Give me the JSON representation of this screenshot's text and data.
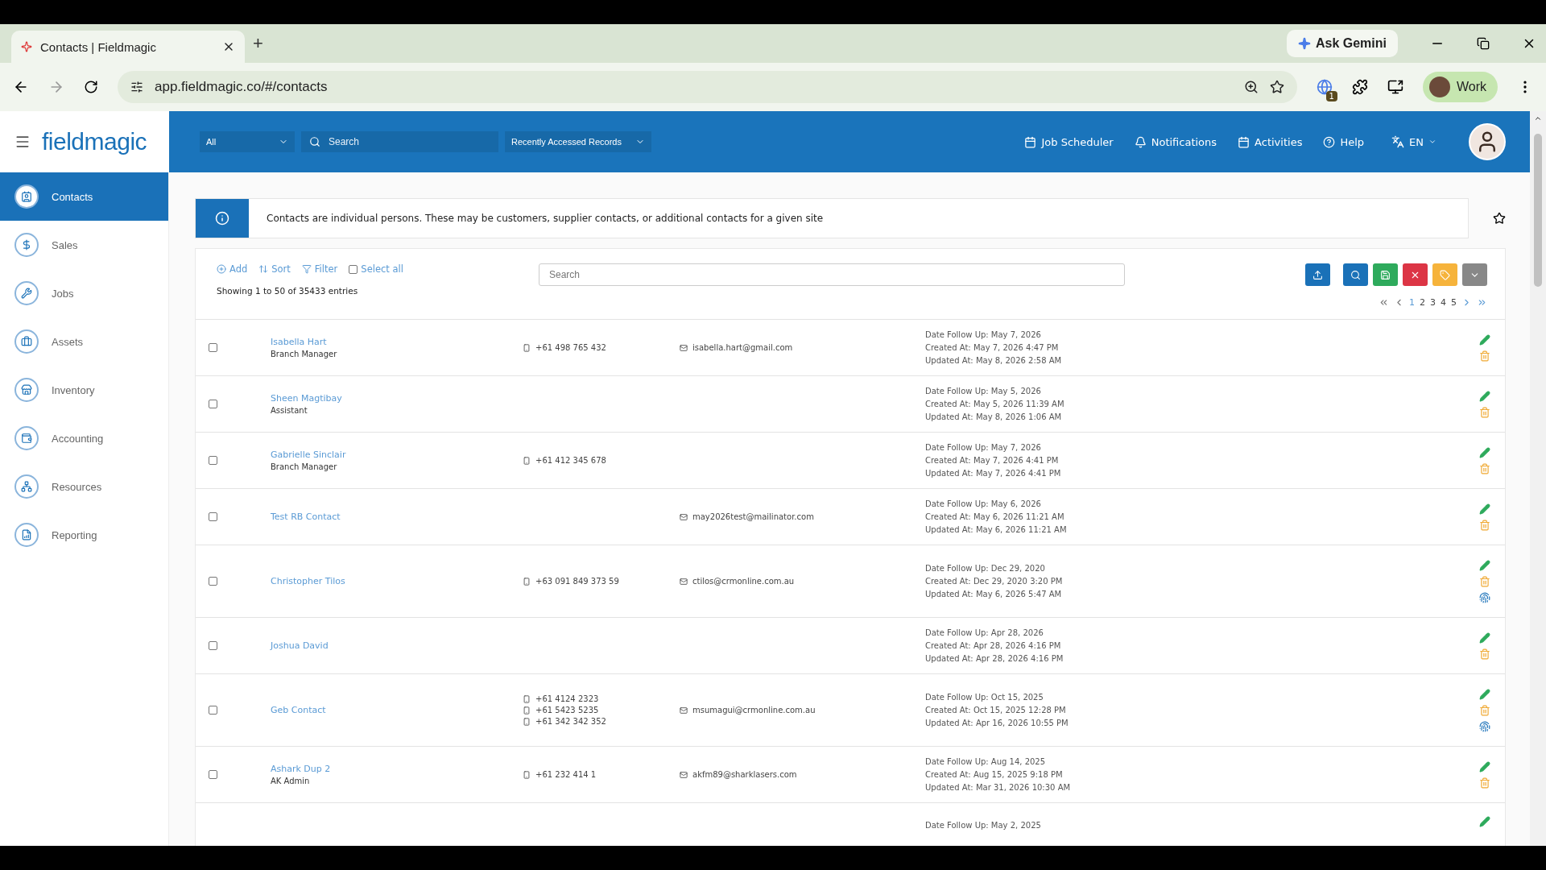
{
  "browser": {
    "tab_title": "Contacts | Fieldmagic",
    "new_tab": "+",
    "ask_gemini": "Ask Gemini",
    "url": "app.fieldmagic.co/#/contacts",
    "extension_badge": "1",
    "profile": "Work"
  },
  "header": {
    "logo": "fieldmagic",
    "scope": "All",
    "search_placeholder": "Search",
    "recent": "Recently Accessed Records",
    "nav": [
      "Job Scheduler",
      "Notifications",
      "Activities",
      "Help"
    ],
    "language": "EN"
  },
  "sidebar": {
    "items": [
      {
        "label": "Contacts",
        "selected": true
      },
      {
        "label": "Sales",
        "selected": false
      },
      {
        "label": "Jobs",
        "selected": false
      },
      {
        "label": "Assets",
        "selected": false
      },
      {
        "label": "Inventory",
        "selected": false
      },
      {
        "label": "Accounting",
        "selected": false
      },
      {
        "label": "Resources",
        "selected": false
      },
      {
        "label": "Reporting",
        "selected": false
      }
    ]
  },
  "info": "Contacts are individual persons. These may be customers, supplier contacts, or additional contacts for a given site",
  "toolbar": {
    "actions": [
      "Add",
      "Sort",
      "Filter"
    ],
    "select_all": {
      "label": "Select all",
      "checked": false
    },
    "search_placeholder": "Search",
    "entries": "Showing 1 to 50 of 35433 entries",
    "pages": [
      {
        "label": "1",
        "selected": true
      },
      {
        "label": "2",
        "selected": false
      },
      {
        "label": "3",
        "selected": false
      },
      {
        "label": "4",
        "selected": false
      },
      {
        "label": "5",
        "selected": false
      }
    ]
  },
  "rows": [
    {
      "checked": false,
      "name": "Isabella Hart",
      "role": "Branch Manager",
      "phones": [
        "+61 498 765 432"
      ],
      "email": "isabella.hart@gmail.com",
      "follow_up": "Date Follow Up: May 7, 2026",
      "created": "Created At: May 7, 2026 4:47 PM",
      "updated": "Updated At: May 8, 2026 2:58 AM",
      "fingerprint": false
    },
    {
      "checked": false,
      "name": "Sheen Magtibay",
      "role": "Assistant",
      "phones": [],
      "follow_up": "Date Follow Up: May 5, 2026",
      "created": "Created At: May 5, 2026 11:39 AM",
      "updated": "Updated At: May 8, 2026 1:06 AM",
      "fingerprint": false
    },
    {
      "checked": false,
      "name": "Gabrielle Sinclair",
      "role": "Branch Manager",
      "phones": [
        "+61 412 345 678"
      ],
      "follow_up": "Date Follow Up: May 7, 2026",
      "created": "Created At: May 7, 2026 4:41 PM",
      "updated": "Updated At: May 7, 2026 4:41 PM",
      "fingerprint": false
    },
    {
      "checked": false,
      "name": "Test RB Contact",
      "phones": [],
      "email": "may2026test@mailinator.com",
      "follow_up": "Date Follow Up: May 6, 2026",
      "created": "Created At: May 6, 2026 11:21 AM",
      "updated": "Updated At: May 6, 2026 11:21 AM",
      "fingerprint": false
    },
    {
      "checked": false,
      "name": "Christopher Tilos",
      "phones": [
        "+63 091 849 373 59"
      ],
      "email": "ctilos@crmonline.com.au",
      "follow_up": "Date Follow Up: Dec 29, 2020",
      "created": "Created At: Dec 29, 2020 3:20 PM",
      "updated": "Updated At: May 6, 2026 5:47 AM",
      "fingerprint": true
    },
    {
      "checked": false,
      "name": "Joshua David",
      "phones": [],
      "follow_up": "Date Follow Up: Apr 28, 2026",
      "created": "Created At: Apr 28, 2026 4:16 PM",
      "updated": "Updated At: Apr 28, 2026 4:16 PM",
      "fingerprint": false
    },
    {
      "checked": false,
      "name": "Geb Contact",
      "phones": [
        "+61 4124 2323",
        "+61 5423 5235",
        "+61 342 342 352"
      ],
      "email": "msumagui@crmonline.com.au",
      "follow_up": "Date Follow Up: Oct 15, 2025",
      "created": "Created At: Oct 15, 2025 12:28 PM",
      "updated": "Updated At: Apr 16, 2026 10:55 PM",
      "fingerprint": true
    },
    {
      "checked": false,
      "name": "Ashark Dup 2",
      "role": "AK Admin",
      "phones": [
        "+61 232 414 1"
      ],
      "email": "akfm89@sharklasers.com",
      "follow_up": "Date Follow Up: Aug 14, 2025",
      "created": "Created At: Aug 15, 2025 9:18 PM",
      "updated": "Updated At: Mar 31, 2026 10:30 AM",
      "fingerprint": false
    },
    {
      "follow_up": "Date Follow Up: May 2, 2025"
    }
  ]
}
